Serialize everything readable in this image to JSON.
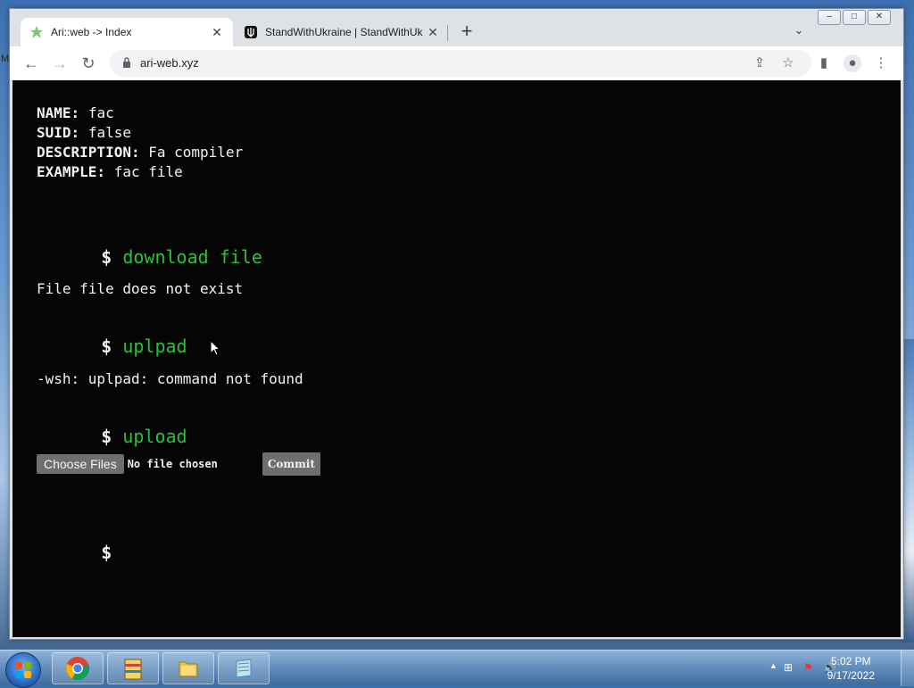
{
  "desktop": {
    "edge_letter": "M"
  },
  "browser": {
    "tabs": [
      {
        "title": "Ari::web -> Index",
        "close": "✕",
        "active": true
      },
      {
        "title": "StandWithUkraine | StandWithUk",
        "close": "✕",
        "active": false
      }
    ],
    "new_tab_symbol": "+",
    "tab_menu_symbol": "⌄",
    "window_controls": {
      "minimize": "–",
      "maximize": "□",
      "close": "✕"
    },
    "nav": {
      "back": "←",
      "forward": "→",
      "reload": "↻"
    },
    "address": {
      "url": "ari-web.xyz"
    },
    "toolbar_icons": {
      "share": "⇪",
      "bookmark": "☆",
      "side_panel": "▮",
      "profile": "●",
      "menu": "⋮"
    }
  },
  "terminal": {
    "info": [
      {
        "key": "NAME:",
        "value": "fac"
      },
      {
        "key": "SUID:",
        "value": "false"
      },
      {
        "key": "DESCRIPTION:",
        "value": "Fa compiler"
      },
      {
        "key": "EXAMPLE:",
        "value": "fac file"
      }
    ],
    "prompt_symbol": "$",
    "entries": [
      {
        "command": "download file",
        "output": "File file does not exist"
      },
      {
        "command": "uplpad",
        "output": "-wsh: uplpad: command not found"
      },
      {
        "command": "upload",
        "output": ""
      }
    ],
    "upload": {
      "choose_label": "Choose Files",
      "status": "No file chosen",
      "commit_label": "Commit"
    }
  },
  "taskbar": {
    "apps": [
      "chrome-icon",
      "archive-icon",
      "folder-icon",
      "notepad-icon"
    ],
    "clock": {
      "time": "5:02 PM",
      "date": "9/17/2022"
    },
    "tray_icons": {
      "show_hidden": "▲",
      "network": "⊞",
      "action_center": "⚑",
      "volume": "🔊"
    }
  },
  "colors": {
    "terminal_bg": "#050505",
    "command_green": "#27c23a",
    "button_gray": "#6e6e6e"
  }
}
